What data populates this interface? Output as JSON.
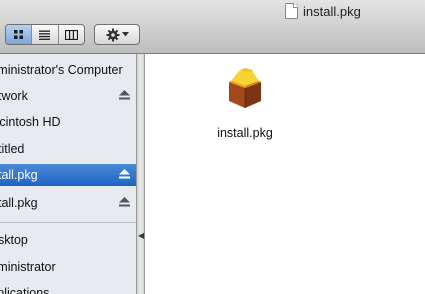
{
  "window": {
    "title": "install.pkg",
    "title_icon": "document-icon"
  },
  "toolbar": {
    "view_modes": [
      {
        "name": "icon-view",
        "icon": "grid-icon",
        "active": true
      },
      {
        "name": "list-view",
        "icon": "list-icon",
        "active": false
      },
      {
        "name": "column-view",
        "icon": "columns-icon",
        "active": false
      }
    ],
    "action_button_icon": "gear-icon"
  },
  "sidebar": {
    "items": [
      {
        "label": "Administrator's Computer",
        "eject": false,
        "selected": false
      },
      {
        "label": "Network",
        "eject": true,
        "selected": false
      },
      {
        "label": "Macintosh HD",
        "eject": false,
        "selected": false
      },
      {
        "label": "Untitled",
        "eject": false,
        "selected": false
      },
      {
        "label": "install.pkg",
        "eject": true,
        "selected": true
      },
      {
        "label": "install.pkg",
        "eject": true,
        "selected": false
      },
      {
        "label": "Desktop",
        "eject": false,
        "selected": false
      },
      {
        "label": "Administrator",
        "eject": false,
        "selected": false
      },
      {
        "label": "Applications",
        "eject": false,
        "selected": false
      }
    ]
  },
  "content": {
    "files": [
      {
        "name": "install.pkg",
        "icon": "package-icon"
      }
    ]
  },
  "colors": {
    "selection": "#1f63c4",
    "sidebar_bg": "#e7ebf1"
  }
}
